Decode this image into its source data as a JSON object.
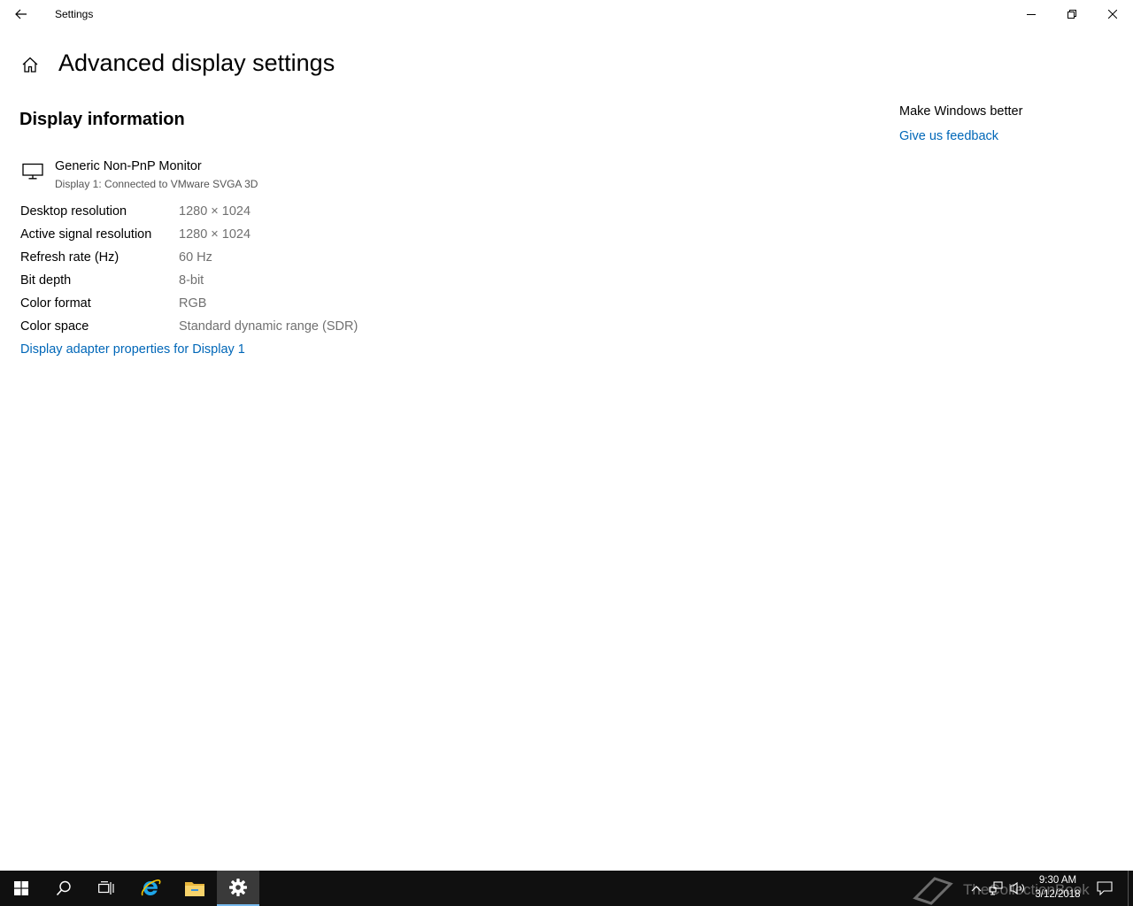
{
  "window": {
    "title": "Settings",
    "controls": [
      "minimize",
      "restore",
      "close"
    ]
  },
  "page": {
    "title": "Advanced display settings"
  },
  "display_info": {
    "section_title": "Display information",
    "monitor_name": "Generic Non-PnP Monitor",
    "monitor_connection": "Display 1: Connected to VMware SVGA 3D",
    "rows": [
      {
        "label": "Desktop resolution",
        "value": "1280 × 1024"
      },
      {
        "label": "Active signal resolution",
        "value": "1280 × 1024"
      },
      {
        "label": "Refresh rate (Hz)",
        "value": "60 Hz"
      },
      {
        "label": "Bit depth",
        "value": "8-bit"
      },
      {
        "label": "Color format",
        "value": "RGB"
      },
      {
        "label": "Color space",
        "value": "Standard dynamic range (SDR)"
      }
    ],
    "adapter_link": "Display adapter properties for Display 1"
  },
  "sidebar": {
    "title": "Make Windows better",
    "feedback_link": "Give us feedback"
  },
  "taskbar": {
    "buttons": [
      "start-icon",
      "search-icon",
      "task-view-icon",
      "internet-explorer-icon",
      "file-explorer-icon",
      "settings-gear-icon"
    ],
    "active_app": "settings-gear-icon",
    "tray_icons": [
      "chevron-up-icon",
      "network-icon",
      "volume-icon",
      "action-center-icon"
    ],
    "watermark": "TheCollectionBook",
    "clock": {
      "time": "9:30 AM",
      "date": "3/12/2018"
    }
  },
  "colors": {
    "accent_link": "#0067b8",
    "value_text": "#707070",
    "taskbar_bg": "#101010"
  }
}
